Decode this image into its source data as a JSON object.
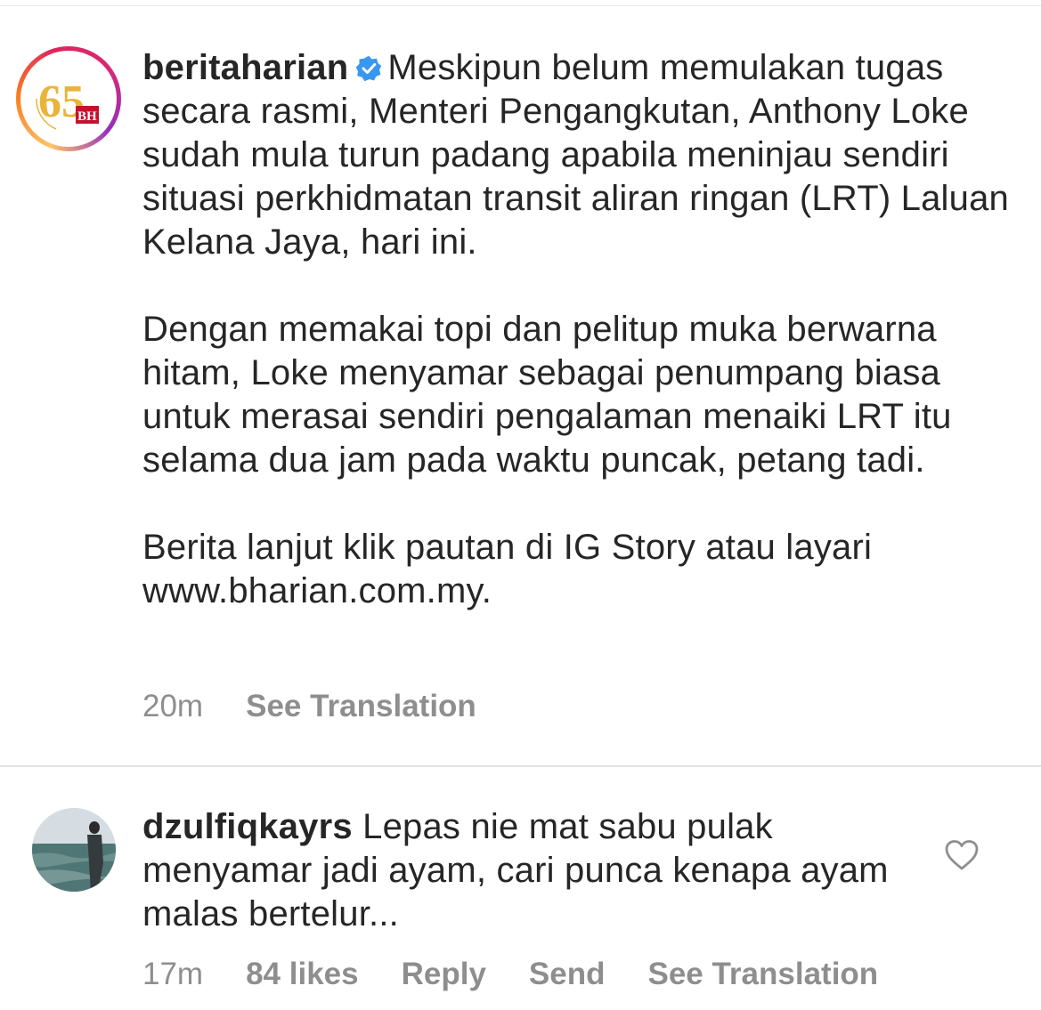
{
  "post": {
    "username": "beritaharian",
    "avatar_badge_number": "65",
    "avatar_badge_initials": "BH",
    "caption_paragraphs": [
      "Meskipun belum memulakan tugas secara rasmi, Menteri Pengangkutan, Anthony Loke sudah mula turun padang apabila meninjau sendiri situasi perkhidmatan transit aliran ringan (LRT) Laluan Kelana Jaya, hari ini.",
      "Dengan memakai topi dan pelitup muka berwarna hitam, Loke menyamar sebagai penumpang biasa untuk merasai sendiri pengalaman menaiki LRT itu selama dua jam pada waktu puncak, petang tadi.",
      "Berita lanjut klik pautan di IG Story atau layari www.bharian.com.my."
    ],
    "time": "20m",
    "see_translation": "See Translation",
    "verified_color": "#3897f0"
  },
  "comment": {
    "username": "dzulfiqkayrs",
    "text": "Lepas nie mat sabu pulak menyamar jadi ayam, cari punca kenapa ayam malas bertelur...",
    "time": "17m",
    "likes": "84 likes",
    "reply": "Reply",
    "send": "Send",
    "see_translation": "See Translation",
    "like_icon": "heart-outline-icon"
  },
  "colors": {
    "text": "#262626",
    "secondary": "#8e8e8e",
    "divider": "#e3e3e3"
  }
}
